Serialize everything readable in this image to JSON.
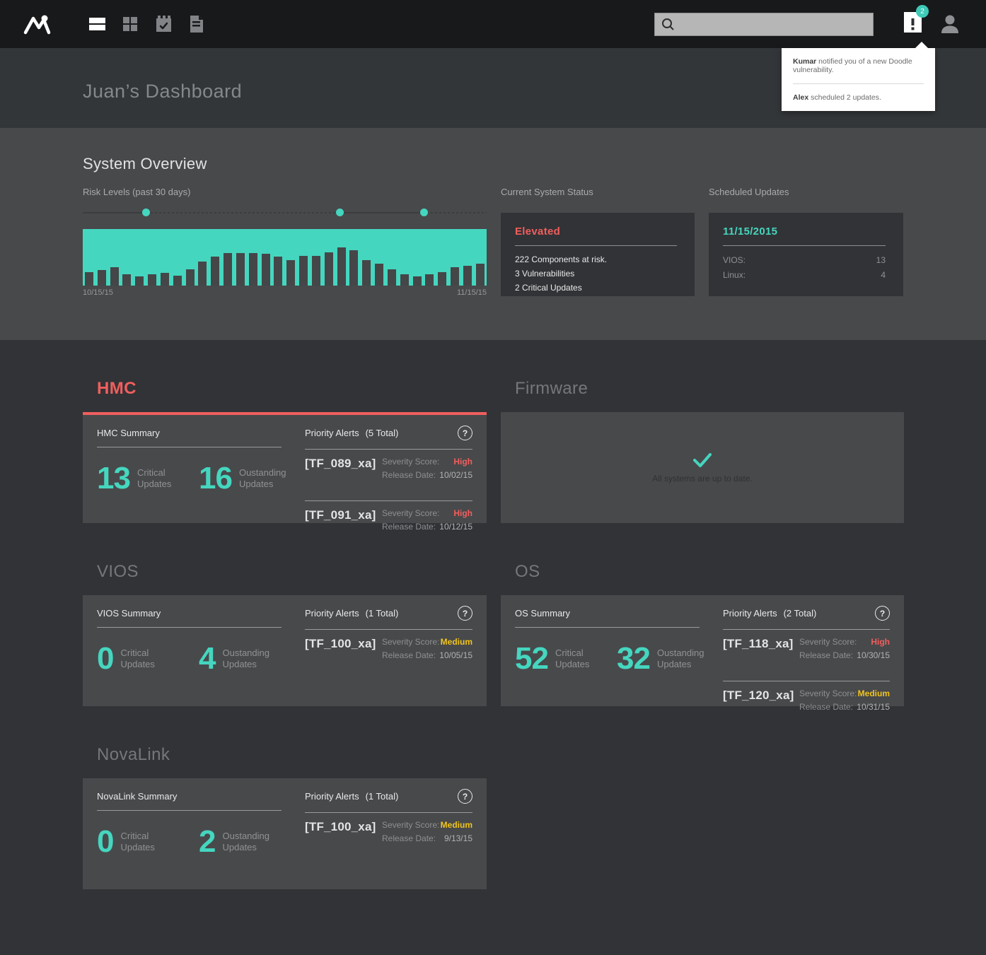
{
  "colors": {
    "teal": "#45d6bf",
    "red": "#f15e5e",
    "yellow": "#f0c41b"
  },
  "navbar": {
    "icons": [
      "rows-icon",
      "grid-icon",
      "calendar-check-icon",
      "document-icon"
    ],
    "badge_count": "2",
    "search": {
      "value": "",
      "placeholder": ""
    }
  },
  "header": {
    "title": "Juan’s Dashboard"
  },
  "notifications": [
    {
      "actor": "Kumar",
      "message": " notified you of a new Doodle vulnerability."
    },
    {
      "actor": "Alex",
      "message": " scheduled 2 updates."
    }
  ],
  "overview": {
    "title": "System Overview",
    "risk_label": "Risk Levels (past 30 days)",
    "date_start": "10/15/15",
    "date_end": "11/15/15",
    "status": {
      "title": "Current System Status",
      "level": "Elevated",
      "lines": [
        "222 Components at risk.",
        "3 Vulnerabilities",
        "2 Critical Updates"
      ]
    },
    "scheduled": {
      "title": "Scheduled Updates",
      "date": "11/15/2015",
      "rows": [
        {
          "label": "VIOS:",
          "value": "13"
        },
        {
          "label": "Linux:",
          "value": "4"
        }
      ]
    }
  },
  "chart_data": {
    "type": "bar",
    "title": "Risk Levels (past 30 days)",
    "x_range": [
      "10/15/15",
      "11/15/15"
    ],
    "ylim": [
      0,
      100
    ],
    "values": [
      24,
      27,
      33,
      20,
      16,
      20,
      22,
      18,
      29,
      43,
      51,
      57,
      57,
      57,
      56,
      51,
      45,
      53,
      53,
      59,
      67,
      63,
      45,
      39,
      29,
      20,
      16,
      20,
      24,
      33,
      35,
      39
    ],
    "bar_color": "#454648",
    "background_color": "#45d6bf",
    "timeline_markers_pct": [
      15.5,
      63.5,
      84.5
    ],
    "grid": false,
    "legend": false
  },
  "sections": [
    {
      "title": "HMC",
      "summary_title": "HMC Summary",
      "stats": [
        {
          "value": "13",
          "label_line1": "Critical",
          "label_line2": "Updates"
        },
        {
          "value": "16",
          "label_line1": "Oustanding",
          "label_line2": "Updates"
        }
      ],
      "alerts_title": "Priority Alerts",
      "alerts_total": "(5 Total)",
      "alerts": [
        {
          "name": "[TF_089_xa]",
          "severity_label": "Severity Score:",
          "severity": "High",
          "severity_class": "sev-high",
          "release_label": "Release Date:",
          "release_date": "10/02/15"
        },
        {
          "name": "[TF_091_xa]",
          "severity_label": "Severity Score:",
          "severity": "High",
          "severity_class": "sev-high",
          "release_label": "Release Date:",
          "release_date": "10/12/15"
        }
      ]
    },
    {
      "title": "Firmware",
      "message": "All systems are up to date."
    },
    {
      "title": "VIOS",
      "summary_title": "VIOS Summary",
      "stats": [
        {
          "value": "0",
          "label_line1": "Critical",
          "label_line2": "Updates"
        },
        {
          "value": "4",
          "label_line1": "Oustanding",
          "label_line2": "Updates"
        }
      ],
      "alerts_title": "Priority Alerts",
      "alerts_total": "(1 Total)",
      "alerts": [
        {
          "name": "[TF_100_xa]",
          "severity_label": "Severity Score:",
          "severity": "Medium",
          "severity_class": "sev-medium",
          "release_label": "Release Date:",
          "release_date": "10/05/15"
        }
      ]
    },
    {
      "title": "OS",
      "summary_title": "OS Summary",
      "stats": [
        {
          "value": "52",
          "label_line1": "Critical",
          "label_line2": "Updates"
        },
        {
          "value": "32",
          "label_line1": "Oustanding",
          "label_line2": "Updates"
        }
      ],
      "alerts_title": "Priority Alerts",
      "alerts_total": "(2 Total)",
      "alerts": [
        {
          "name": "[TF_118_xa]",
          "severity_label": "Severity Score:",
          "severity": "High",
          "severity_class": "sev-high",
          "release_label": "Release Date:",
          "release_date": "10/30/15"
        },
        {
          "name": "[TF_120_xa]",
          "severity_label": "Severity Score:",
          "severity": "Medium",
          "severity_class": "sev-medium",
          "release_label": "Release Date:",
          "release_date": "10/31/15"
        }
      ]
    },
    {
      "title": "NovaLink",
      "summary_title": "NovaLink Summary",
      "stats": [
        {
          "value": "0",
          "label_line1": "Critical",
          "label_line2": "Updates"
        },
        {
          "value": "2",
          "label_line1": "Oustanding",
          "label_line2": "Updates"
        }
      ],
      "alerts_title": "Priority Alerts",
      "alerts_total": "(1 Total)",
      "alerts": [
        {
          "name": "[TF_100_xa]",
          "severity_label": "Severity Score:",
          "severity": "Medium",
          "severity_class": "sev-medium",
          "release_label": "Release Date:",
          "release_date": "9/13/15"
        }
      ]
    }
  ]
}
